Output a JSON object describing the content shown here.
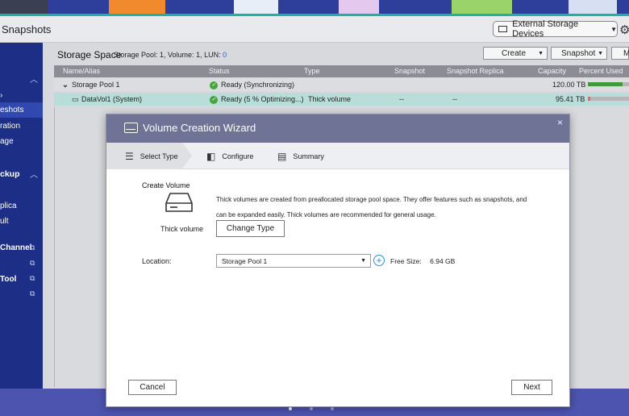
{
  "app": {
    "title": "Snapshots",
    "external_storage": "External Storage Devices"
  },
  "sidebar": {
    "items": [
      {
        "label": "eshots"
      },
      {
        "label": "ration"
      },
      {
        "label": "age"
      },
      {
        "label": "ckup"
      },
      {
        "label": "plica"
      },
      {
        "label": "ult"
      },
      {
        "label": "Channel"
      },
      {
        "label": "Tool"
      }
    ]
  },
  "storage": {
    "title": "Storage Space",
    "sub_pool_label": "Storage Pool: 1, Volume: 1, LUN:",
    "sub_lun_count": "0",
    "buttons": {
      "create": "Create",
      "snapshot": "Snapshot",
      "more": "M"
    }
  },
  "table": {
    "headers": [
      "Name/Alias",
      "Status",
      "Type",
      "Snapshot",
      "Snapshot Replica",
      "Capacity",
      "Percent Used"
    ],
    "rows": [
      {
        "name": "Storage Pool 1",
        "status": "Ready (Synchronizing)",
        "type": "",
        "snapshot": "",
        "replica": "",
        "capacity": "120.00 TB",
        "percent_used": 0.85
      },
      {
        "name": "DataVol1 (System)",
        "status": "Ready (5 % Optimizing...)",
        "type": "Thick volume",
        "snapshot": "--",
        "replica": "--",
        "capacity": "95.41 TB",
        "percent_used": 0.05
      }
    ]
  },
  "wizard": {
    "title": "Volume Creation Wizard",
    "steps": [
      "Select Type",
      "Configure",
      "Summary"
    ],
    "section_title": "Create Volume",
    "volume_type_label": "Thick volume",
    "description": "Thick volumes are created from preallocated storage pool space. They offer features such as snapshots, and can be expanded easily. Thick volumes are recommended for general usage.",
    "change_type": "Change Type",
    "location_label": "Location:",
    "location_value": "Storage Pool 1",
    "free_size_label": "Free Size:",
    "free_size_value": "6.94 GB",
    "cancel": "Cancel",
    "next": "Next",
    "close": "×"
  },
  "colors": {
    "sidebar": "#1c2e85",
    "header": "#6f7497",
    "selected_row": "#b9ded9",
    "ok": "#45a63c",
    "link": "#2a62c9"
  }
}
